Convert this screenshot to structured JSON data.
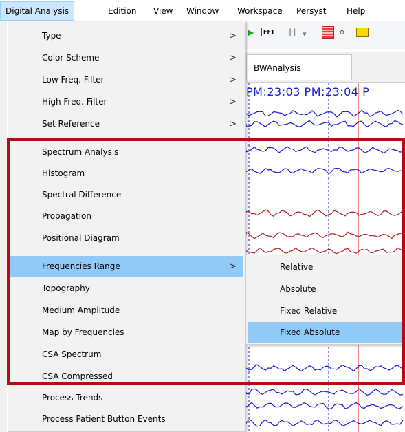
{
  "menubar": {
    "items": [
      "Digital Analysis",
      "Edition",
      "View",
      "Window",
      "Workspace",
      "Persyst",
      "Help"
    ]
  },
  "menu": {
    "items": [
      {
        "label": "Type",
        "submenu": true
      },
      {
        "label": "Color Scheme",
        "submenu": true
      },
      {
        "label": "Low Freq. Filter",
        "submenu": true
      },
      {
        "label": "High Freq. Filter",
        "submenu": true
      },
      {
        "label": "Set Reference",
        "submenu": true
      },
      {
        "label": "Spectrum Analysis"
      },
      {
        "label": "Histogram"
      },
      {
        "label": "Spectral Difference"
      },
      {
        "label": "Propagation"
      },
      {
        "label": "Positional Diagram"
      },
      {
        "label": "Frequencies Range",
        "submenu": true,
        "highlighted": true
      },
      {
        "label": "Topography"
      },
      {
        "label": "Medium Amplitude"
      },
      {
        "label": "Map by Frequencies"
      },
      {
        "label": "CSA Spectrum"
      },
      {
        "label": "CSA Compressed"
      },
      {
        "label": "Process Trends"
      },
      {
        "label": "Process Patient Button Events"
      }
    ],
    "submenu_arrow": ">"
  },
  "submenu": {
    "items": [
      {
        "label": "Relative"
      },
      {
        "label": "Absolute"
      },
      {
        "label": "Fixed Relative"
      },
      {
        "label": "Fixed Absolute",
        "highlighted": true
      }
    ]
  },
  "background": {
    "tab_label": "BWAnalysis",
    "time_label": "PM:23:03 PM:23:04 P",
    "toolbar_fft": "FFT",
    "toolbar_h": "H",
    "toolbar_dropdown": "▾"
  },
  "colors": {
    "highlight": "#91c9f7",
    "menu_bg": "#f2f2f2",
    "annotation_box": "#b50b14",
    "eeg_blue": "#1a1ad8",
    "eeg_red": "#b02020"
  }
}
